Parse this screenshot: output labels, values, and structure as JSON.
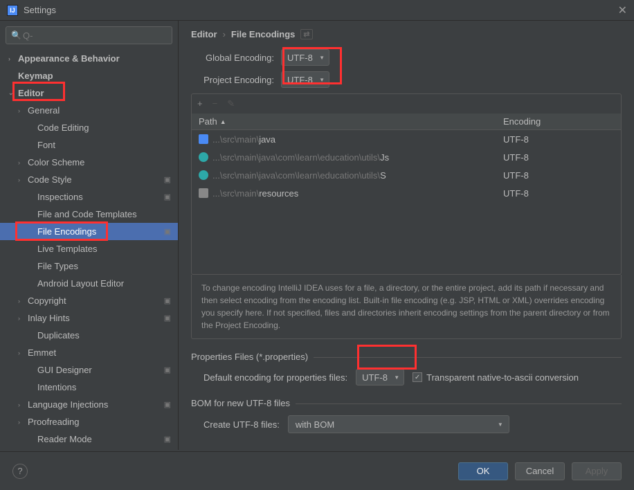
{
  "window": {
    "title": "Settings"
  },
  "search": {
    "placeholder": "Q-"
  },
  "breadcrumb": {
    "root": "Editor",
    "sep": "›",
    "leaf": "File Encodings"
  },
  "sidebar": {
    "items": [
      {
        "label": "Appearance & Behavior",
        "arrow": "›",
        "bold": true,
        "lvl": 0
      },
      {
        "label": "Keymap",
        "arrow": "",
        "bold": true,
        "lvl": 0
      },
      {
        "label": "Editor",
        "arrow": "⌄",
        "bold": true,
        "lvl": 0
      },
      {
        "label": "General",
        "arrow": "›",
        "lvl": 1
      },
      {
        "label": "Code Editing",
        "arrow": "",
        "lvl": 2
      },
      {
        "label": "Font",
        "arrow": "",
        "lvl": 2
      },
      {
        "label": "Color Scheme",
        "arrow": "›",
        "lvl": 1
      },
      {
        "label": "Code Style",
        "arrow": "›",
        "lvl": 1,
        "badge": "▣"
      },
      {
        "label": "Inspections",
        "arrow": "",
        "lvl": 2,
        "badge": "▣"
      },
      {
        "label": "File and Code Templates",
        "arrow": "",
        "lvl": 2
      },
      {
        "label": "File Encodings",
        "arrow": "",
        "lvl": 2,
        "selected": true,
        "badge": "▣"
      },
      {
        "label": "Live Templates",
        "arrow": "",
        "lvl": 2
      },
      {
        "label": "File Types",
        "arrow": "",
        "lvl": 2
      },
      {
        "label": "Android Layout Editor",
        "arrow": "",
        "lvl": 2
      },
      {
        "label": "Copyright",
        "arrow": "›",
        "lvl": 1,
        "badge": "▣"
      },
      {
        "label": "Inlay Hints",
        "arrow": "›",
        "lvl": 1,
        "badge": "▣"
      },
      {
        "label": "Duplicates",
        "arrow": "",
        "lvl": 2
      },
      {
        "label": "Emmet",
        "arrow": "›",
        "lvl": 1
      },
      {
        "label": "GUI Designer",
        "arrow": "",
        "lvl": 2,
        "badge": "▣"
      },
      {
        "label": "Intentions",
        "arrow": "",
        "lvl": 2
      },
      {
        "label": "Language Injections",
        "arrow": "›",
        "lvl": 1,
        "badge": "▣"
      },
      {
        "label": "Proofreading",
        "arrow": "›",
        "lvl": 1
      },
      {
        "label": "Reader Mode",
        "arrow": "",
        "lvl": 2,
        "badge": "▣"
      }
    ]
  },
  "encoding": {
    "global_label": "Global Encoding:",
    "global_value": "UTF-8",
    "project_label": "Project Encoding:",
    "project_value": "UTF-8"
  },
  "table": {
    "col_path": "Path",
    "col_enc": "Encoding",
    "sort": "▲",
    "rows": [
      {
        "icon": "folder",
        "dim": "...\\src\\main\\",
        "name": "java",
        "enc": "UTF-8"
      },
      {
        "icon": "java",
        "dim": "...\\src\\main\\java\\com\\learn\\education\\utils\\",
        "name": "Js",
        "enc": "UTF-8"
      },
      {
        "icon": "java",
        "dim": "...\\src\\main\\java\\com\\learn\\education\\utils\\",
        "name": "S",
        "enc": "UTF-8"
      },
      {
        "icon": "res",
        "dim": "...\\src\\main\\",
        "name": "resources",
        "enc": "UTF-8"
      }
    ]
  },
  "info": "To change encoding IntelliJ IDEA uses for a file, a directory, or the entire project, add its path if necessary and then select encoding from the encoding list. Built-in file encoding (e.g. JSP, HTML or XML) overrides encoding you specify here. If not specified, files and directories inherit encoding settings from the parent directory or from the Project Encoding.",
  "props": {
    "section": "Properties Files (*.properties)",
    "label": "Default encoding for properties files:",
    "value": "UTF-8",
    "checkbox": "Transparent native-to-ascii conversion"
  },
  "bom": {
    "section": "BOM for new UTF-8 files",
    "label": "Create UTF-8 files:",
    "value": "with BOM"
  },
  "footer": {
    "ok": "OK",
    "cancel": "Cancel",
    "apply": "Apply"
  }
}
